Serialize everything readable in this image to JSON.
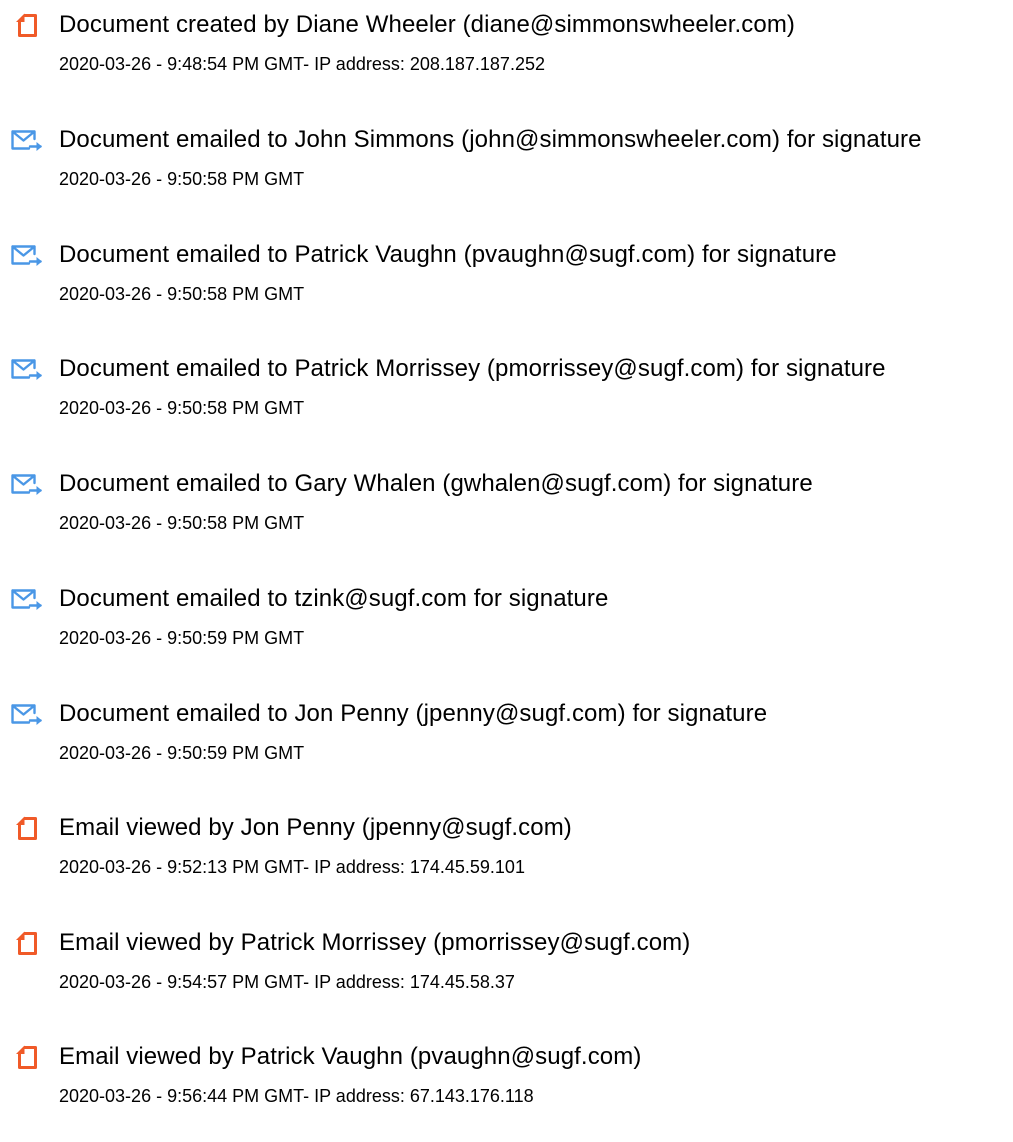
{
  "colors": {
    "doc_icon": "#f05a28",
    "email_icon": "#4a97e6",
    "text": "#000000"
  },
  "events": [
    {
      "icon": "document-icon",
      "title": "Document created by Diane Wheeler (diane@simmonswheeler.com)",
      "meta": "2020-03-26 - 9:48:54 PM GMT- IP address: 208.187.187.252"
    },
    {
      "icon": "email-sent-icon",
      "title": "Document emailed to John Simmons (john@simmonswheeler.com) for signature",
      "meta": "2020-03-26 - 9:50:58 PM GMT"
    },
    {
      "icon": "email-sent-icon",
      "title": "Document emailed to Patrick Vaughn (pvaughn@sugf.com) for signature",
      "meta": "2020-03-26 - 9:50:58 PM GMT"
    },
    {
      "icon": "email-sent-icon",
      "title": "Document emailed to Patrick Morrissey (pmorrissey@sugf.com) for signature",
      "meta": "2020-03-26 - 9:50:58 PM GMT"
    },
    {
      "icon": "email-sent-icon",
      "title": "Document emailed to Gary Whalen (gwhalen@sugf.com) for signature",
      "meta": "2020-03-26 - 9:50:58 PM GMT"
    },
    {
      "icon": "email-sent-icon",
      "title": "Document emailed to tzink@sugf.com for signature",
      "meta": "2020-03-26 - 9:50:59 PM GMT"
    },
    {
      "icon": "email-sent-icon",
      "title": "Document emailed to Jon Penny (jpenny@sugf.com) for signature",
      "meta": "2020-03-26 - 9:50:59 PM GMT"
    },
    {
      "icon": "document-icon",
      "title": "Email viewed by Jon Penny (jpenny@sugf.com)",
      "meta": "2020-03-26 - 9:52:13 PM GMT- IP address: 174.45.59.101"
    },
    {
      "icon": "document-icon",
      "title": "Email viewed by Patrick Morrissey (pmorrissey@sugf.com)",
      "meta": "2020-03-26 - 9:54:57 PM GMT- IP address: 174.45.58.37"
    },
    {
      "icon": "document-icon",
      "title": "Email viewed by Patrick Vaughn (pvaughn@sugf.com)",
      "meta": "2020-03-26 - 9:56:44 PM GMT- IP address: 67.143.176.118"
    }
  ]
}
